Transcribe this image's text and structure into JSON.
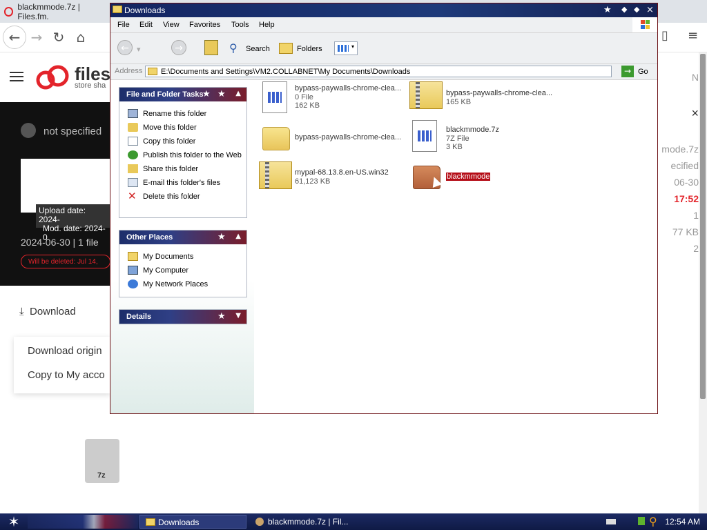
{
  "browser": {
    "tab_title": "blackmmode.7z | Files.fm.",
    "nav": {
      "back": "←",
      "forward": "→",
      "reload": "↻",
      "home": "⌂"
    },
    "site": {
      "logo_text": "files",
      "logo_sub": "store sha",
      "user": "not specified",
      "tooltip_line1": "Upload date: 2024-",
      "tooltip_line2": "Mod. date: 2024-0",
      "date_files": "2024-06-30 | 1 file",
      "will_be_deleted": "Will be deleted: Jul 14,",
      "download_label": "Download",
      "menu_item_1": "Download origin",
      "menu_item_2": "Copy to My acco",
      "file_ext": "7z",
      "right_items": [
        "N",
        "×",
        "mode.7z",
        "ecified",
        "06-30",
        "17:52",
        "1",
        "77 KB",
        "2"
      ]
    }
  },
  "explorer": {
    "title": "Downloads",
    "menu": [
      "File",
      "Edit",
      "View",
      "Favorites",
      "Tools",
      "Help"
    ],
    "toolbar": {
      "back": "Back",
      "search": "Search",
      "folders": "Folders"
    },
    "address_label": "Address",
    "address_value": "E:\\Documents and Settings\\VM2.COLLABNET\\My Documents\\Downloads",
    "go_label": "Go",
    "tasks": {
      "header": "File and Folder Tasks",
      "items": [
        "Rename this folder",
        "Move this folder",
        "Copy this folder",
        "Publish this folder to the Web",
        "Share this folder",
        "E-mail this folder's files",
        "Delete this folder"
      ]
    },
    "places": {
      "header": "Other Places",
      "items": [
        "My Documents",
        "My Computer",
        "My Network Places"
      ]
    },
    "details": {
      "header": "Details"
    },
    "files": [
      {
        "name": "bypass-paywalls-chrome-clea...",
        "type": "File",
        "size": "0 File",
        "size2": "162 KB",
        "icon": "document-icon"
      },
      {
        "name": "bypass-paywalls-chrome-clea...",
        "type": "zip",
        "size": "165 KB",
        "size2": "",
        "icon": "zip-folder-icon"
      },
      {
        "name": "bypass-paywalls-chrome-clea...",
        "type": "folder",
        "size": "",
        "size2": "",
        "icon": "folder-icon"
      },
      {
        "name": "blackmmode.7z",
        "type": "7Z File",
        "size": "7Z File",
        "size2": "3 KB",
        "icon": "document-icon"
      },
      {
        "name": "mypal-68.13.8.en-US.win32",
        "type": "zip",
        "size": "61,123 KB",
        "size2": "",
        "icon": "zip-folder-icon"
      },
      {
        "name": "blackmmode",
        "type": "folder",
        "size": "",
        "size2": "",
        "icon": "folder-icon"
      }
    ]
  },
  "taskbar": {
    "tasks": [
      "Downloads",
      "blackmmode.7z | Fil..."
    ],
    "clock": "12:54 AM"
  },
  "colors": {
    "accent_red": "#b50d17",
    "navy": "#1d2e6a",
    "brand_red": "#e3242b"
  }
}
